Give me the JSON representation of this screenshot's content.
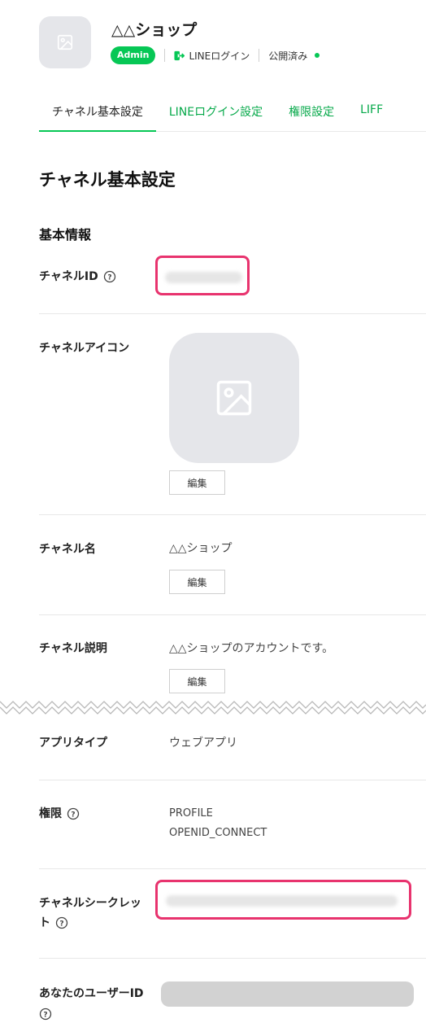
{
  "header": {
    "title": "△△ショップ",
    "badge": "Admin",
    "login_label": "LINEログイン",
    "status": "公開済み",
    "brand_color": "#06c755"
  },
  "tabs": [
    {
      "label": "チャネル基本設定",
      "active": true
    },
    {
      "label": "LINEログイン設定",
      "active": false
    },
    {
      "label": "権限設定",
      "active": false
    },
    {
      "label": "LIFF",
      "active": false
    }
  ],
  "page_title": "チャネル基本設定",
  "section_title": "基本情報",
  "fields": {
    "channel_id": {
      "label": "チャネルID"
    },
    "channel_icon": {
      "label": "チャネルアイコン",
      "edit": "編集"
    },
    "channel_name": {
      "label": "チャネル名",
      "value": "△△ショップ",
      "edit": "編集"
    },
    "channel_desc": {
      "label": "チャネル説明",
      "value": "△△ショップのアカウントです。",
      "edit": "編集"
    },
    "app_type": {
      "label": "アプリタイプ",
      "value": "ウェブアプリ"
    },
    "permissions": {
      "label": "権限",
      "values": [
        "PROFILE",
        "OPENID_CONNECT"
      ]
    },
    "channel_secret": {
      "label_line1": "チャネルシークレッ",
      "label_line2": "ト"
    },
    "user_id": {
      "label": "あなたのユーザーID"
    }
  },
  "highlight_color": "#e8336e"
}
